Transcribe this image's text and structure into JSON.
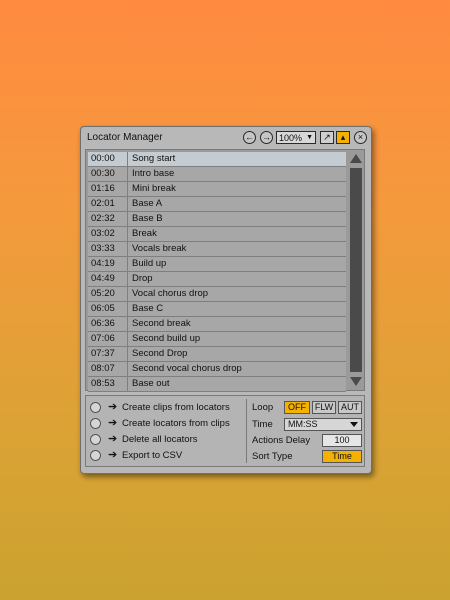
{
  "window": {
    "title": "Locator Manager",
    "zoom": "100%",
    "accent_color": "#f5b100"
  },
  "icons": {
    "back": "circle-arrow-left-icon",
    "forward": "circle-arrow-right-icon",
    "expand": "expand-icon",
    "pin": "pin-icon",
    "close": "close-icon"
  },
  "locators": [
    {
      "time": "00:00",
      "name": "Song start"
    },
    {
      "time": "00:30",
      "name": "Intro base"
    },
    {
      "time": "01:16",
      "name": "Mini break"
    },
    {
      "time": "02:01",
      "name": "Base A"
    },
    {
      "time": "02:32",
      "name": "Base B"
    },
    {
      "time": "03:02",
      "name": "Break"
    },
    {
      "time": "03:33",
      "name": "Vocals break"
    },
    {
      "time": "04:19",
      "name": "Build up"
    },
    {
      "time": "04:49",
      "name": "Drop"
    },
    {
      "time": "05:20",
      "name": "Vocal chorus drop"
    },
    {
      "time": "06:05",
      "name": "Base C"
    },
    {
      "time": "06:36",
      "name": "Second break"
    },
    {
      "time": "07:06",
      "name": "Second build up"
    },
    {
      "time": "07:37",
      "name": "Second Drop"
    },
    {
      "time": "08:07",
      "name": "Second vocal chorus drop"
    },
    {
      "time": "08:53",
      "name": "Base out"
    }
  ],
  "actions": [
    {
      "label": "Create clips from locators"
    },
    {
      "label": "Create locators from clips"
    },
    {
      "label": "Delete all locators"
    },
    {
      "label": "Export to CSV"
    }
  ],
  "settings": {
    "loop_label": "Loop",
    "loop_options": [
      "OFF",
      "FLW",
      "AUT"
    ],
    "loop_selected": "OFF",
    "time_label": "Time",
    "time_value": "MM:SS",
    "delay_label": "Actions Delay",
    "delay_value": "100",
    "sort_label": "Sort Type",
    "sort_value": "Time"
  }
}
